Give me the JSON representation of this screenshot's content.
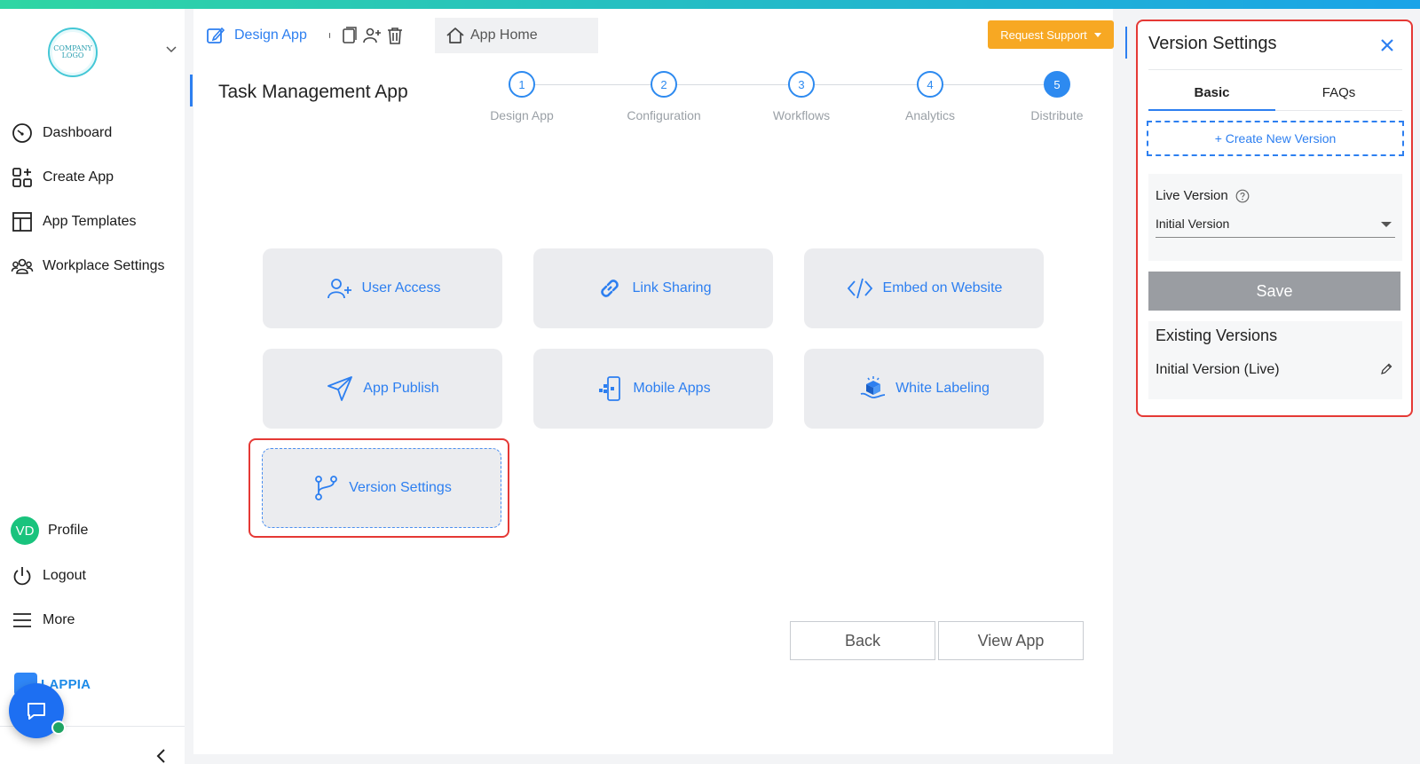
{
  "sidebar": {
    "logo_text_line1": "COMPANY",
    "logo_text_line2": "LOGO",
    "items": [
      {
        "label": "Dashboard",
        "icon": "gauge-icon"
      },
      {
        "label": "Create App",
        "icon": "add-grid-icon"
      },
      {
        "label": "App Templates",
        "icon": "template-icon"
      },
      {
        "label": "Workplace Settings",
        "icon": "users-group-icon"
      }
    ],
    "profile": {
      "initials": "VD",
      "label": "Profile"
    },
    "logout_label": "Logout",
    "more_label": "More",
    "brand_text": "LAPPIA"
  },
  "header": {
    "design_tab": "Design App",
    "home_tab": "App Home",
    "request_support": "Request Support"
  },
  "app_title": "Task Management App",
  "steps": [
    {
      "num": "1",
      "label": "Design App"
    },
    {
      "num": "2",
      "label": "Configuration"
    },
    {
      "num": "3",
      "label": "Workflows"
    },
    {
      "num": "4",
      "label": "Analytics"
    },
    {
      "num": "5",
      "label": "Distribute"
    }
  ],
  "cards": {
    "user_access": "User Access",
    "link_sharing": "Link Sharing",
    "embed": "Embed on Website",
    "app_publish": "App Publish",
    "mobile_apps": "Mobile Apps",
    "white_labeling": "White Labeling",
    "version_settings": "Version Settings"
  },
  "footer": {
    "back": "Back",
    "view_app": "View App"
  },
  "panel": {
    "title": "Version Settings",
    "tabs": [
      "Basic",
      "FAQs"
    ],
    "create_new": "+ Create New Version",
    "live_version_label": "Live Version",
    "live_version_value": "Initial Version",
    "save": "Save",
    "existing_title": "Existing Versions",
    "existing_item": "Initial Version (Live)"
  },
  "colors": {
    "accent": "#2d7ff0",
    "warning": "#f7a823",
    "highlight": "#e53935"
  }
}
